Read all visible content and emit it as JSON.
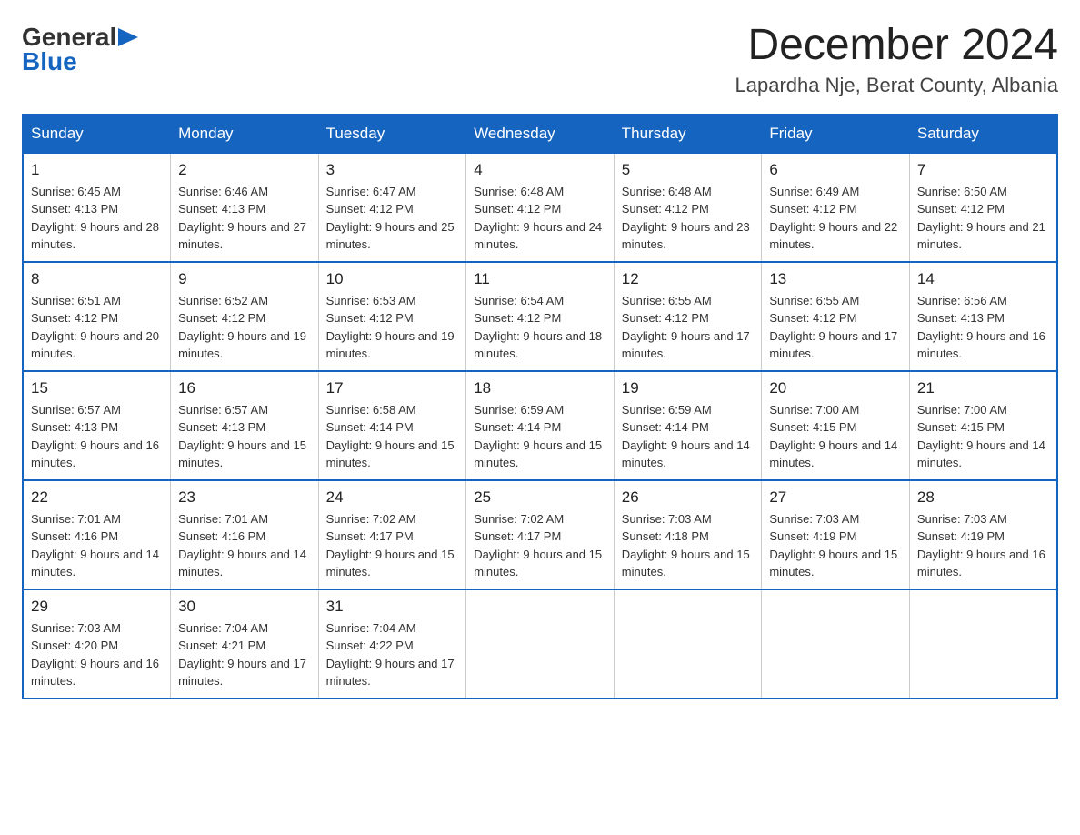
{
  "logo": {
    "general": "General",
    "arrow": "▶",
    "blue": "Blue"
  },
  "title": "December 2024",
  "subtitle": "Lapardha Nje, Berat County, Albania",
  "days_of_week": [
    "Sunday",
    "Monday",
    "Tuesday",
    "Wednesday",
    "Thursday",
    "Friday",
    "Saturday"
  ],
  "weeks": [
    [
      {
        "day": "1",
        "sunrise": "6:45 AM",
        "sunset": "4:13 PM",
        "daylight": "9 hours and 28 minutes."
      },
      {
        "day": "2",
        "sunrise": "6:46 AM",
        "sunset": "4:13 PM",
        "daylight": "9 hours and 27 minutes."
      },
      {
        "day": "3",
        "sunrise": "6:47 AM",
        "sunset": "4:12 PM",
        "daylight": "9 hours and 25 minutes."
      },
      {
        "day": "4",
        "sunrise": "6:48 AM",
        "sunset": "4:12 PM",
        "daylight": "9 hours and 24 minutes."
      },
      {
        "day": "5",
        "sunrise": "6:48 AM",
        "sunset": "4:12 PM",
        "daylight": "9 hours and 23 minutes."
      },
      {
        "day": "6",
        "sunrise": "6:49 AM",
        "sunset": "4:12 PM",
        "daylight": "9 hours and 22 minutes."
      },
      {
        "day": "7",
        "sunrise": "6:50 AM",
        "sunset": "4:12 PM",
        "daylight": "9 hours and 21 minutes."
      }
    ],
    [
      {
        "day": "8",
        "sunrise": "6:51 AM",
        "sunset": "4:12 PM",
        "daylight": "9 hours and 20 minutes."
      },
      {
        "day": "9",
        "sunrise": "6:52 AM",
        "sunset": "4:12 PM",
        "daylight": "9 hours and 19 minutes."
      },
      {
        "day": "10",
        "sunrise": "6:53 AM",
        "sunset": "4:12 PM",
        "daylight": "9 hours and 19 minutes."
      },
      {
        "day": "11",
        "sunrise": "6:54 AM",
        "sunset": "4:12 PM",
        "daylight": "9 hours and 18 minutes."
      },
      {
        "day": "12",
        "sunrise": "6:55 AM",
        "sunset": "4:12 PM",
        "daylight": "9 hours and 17 minutes."
      },
      {
        "day": "13",
        "sunrise": "6:55 AM",
        "sunset": "4:12 PM",
        "daylight": "9 hours and 17 minutes."
      },
      {
        "day": "14",
        "sunrise": "6:56 AM",
        "sunset": "4:13 PM",
        "daylight": "9 hours and 16 minutes."
      }
    ],
    [
      {
        "day": "15",
        "sunrise": "6:57 AM",
        "sunset": "4:13 PM",
        "daylight": "9 hours and 16 minutes."
      },
      {
        "day": "16",
        "sunrise": "6:57 AM",
        "sunset": "4:13 PM",
        "daylight": "9 hours and 15 minutes."
      },
      {
        "day": "17",
        "sunrise": "6:58 AM",
        "sunset": "4:14 PM",
        "daylight": "9 hours and 15 minutes."
      },
      {
        "day": "18",
        "sunrise": "6:59 AM",
        "sunset": "4:14 PM",
        "daylight": "9 hours and 15 minutes."
      },
      {
        "day": "19",
        "sunrise": "6:59 AM",
        "sunset": "4:14 PM",
        "daylight": "9 hours and 14 minutes."
      },
      {
        "day": "20",
        "sunrise": "7:00 AM",
        "sunset": "4:15 PM",
        "daylight": "9 hours and 14 minutes."
      },
      {
        "day": "21",
        "sunrise": "7:00 AM",
        "sunset": "4:15 PM",
        "daylight": "9 hours and 14 minutes."
      }
    ],
    [
      {
        "day": "22",
        "sunrise": "7:01 AM",
        "sunset": "4:16 PM",
        "daylight": "9 hours and 14 minutes."
      },
      {
        "day": "23",
        "sunrise": "7:01 AM",
        "sunset": "4:16 PM",
        "daylight": "9 hours and 14 minutes."
      },
      {
        "day": "24",
        "sunrise": "7:02 AM",
        "sunset": "4:17 PM",
        "daylight": "9 hours and 15 minutes."
      },
      {
        "day": "25",
        "sunrise": "7:02 AM",
        "sunset": "4:17 PM",
        "daylight": "9 hours and 15 minutes."
      },
      {
        "day": "26",
        "sunrise": "7:03 AM",
        "sunset": "4:18 PM",
        "daylight": "9 hours and 15 minutes."
      },
      {
        "day": "27",
        "sunrise": "7:03 AM",
        "sunset": "4:19 PM",
        "daylight": "9 hours and 15 minutes."
      },
      {
        "day": "28",
        "sunrise": "7:03 AM",
        "sunset": "4:19 PM",
        "daylight": "9 hours and 16 minutes."
      }
    ],
    [
      {
        "day": "29",
        "sunrise": "7:03 AM",
        "sunset": "4:20 PM",
        "daylight": "9 hours and 16 minutes."
      },
      {
        "day": "30",
        "sunrise": "7:04 AM",
        "sunset": "4:21 PM",
        "daylight": "9 hours and 17 minutes."
      },
      {
        "day": "31",
        "sunrise": "7:04 AM",
        "sunset": "4:22 PM",
        "daylight": "9 hours and 17 minutes."
      },
      null,
      null,
      null,
      null
    ]
  ],
  "labels": {
    "sunrise": "Sunrise:",
    "sunset": "Sunset:",
    "daylight": "Daylight:"
  }
}
